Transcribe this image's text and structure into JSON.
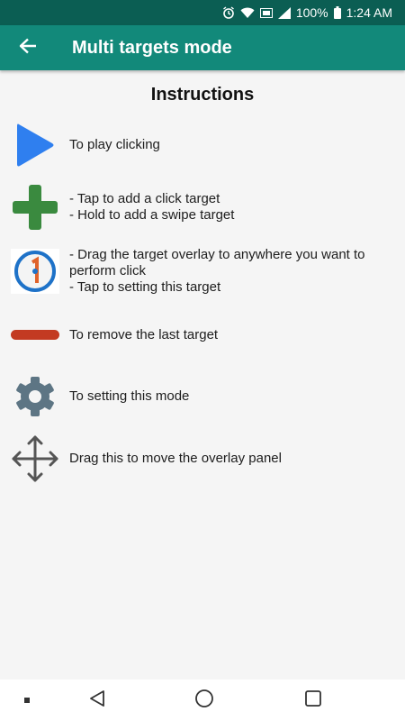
{
  "status_bar": {
    "battery_percent": "100%",
    "time": "1:24 AM",
    "icons": [
      "alarm-icon",
      "wifi-icon",
      "volte-icon",
      "signal-icon",
      "battery-icon"
    ]
  },
  "app_bar": {
    "title": "Multi targets mode",
    "back_icon": "arrow-back-icon",
    "background": "#12897a",
    "status_background": "#0b5e53"
  },
  "instructions": {
    "heading": "Instructions",
    "items": [
      {
        "icon": "play-icon",
        "color": "#2f7fef",
        "lines": [
          "To play clicking"
        ]
      },
      {
        "icon": "plus-icon",
        "color": "#3a8a3f",
        "lines": [
          "- Tap to add a click target",
          "- Hold to add a swipe target"
        ]
      },
      {
        "icon": "target-icon",
        "color": "#1e72c8",
        "lines": [
          "- Drag the target overlay to anywhere you want to perform click",
          "- Tap to setting this target"
        ]
      },
      {
        "icon": "minus-icon",
        "color": "#c33a22",
        "lines": [
          "To remove the last target"
        ]
      },
      {
        "icon": "gear-icon",
        "color": "#5d7584",
        "lines": [
          "To setting this mode"
        ]
      },
      {
        "icon": "move-icon",
        "color": "#555555",
        "lines": [
          "Drag this to move the overlay panel"
        ]
      }
    ]
  },
  "nav_bar": {
    "items": [
      "recents-dot-icon",
      "back-triangle-icon",
      "home-circle-icon",
      "overview-square-icon"
    ]
  }
}
